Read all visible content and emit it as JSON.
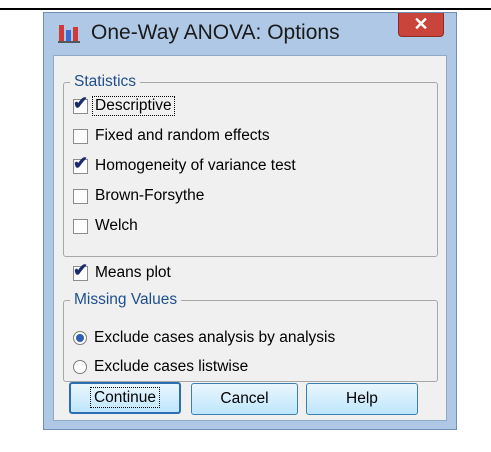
{
  "window": {
    "title": "One-Way ANOVA: Options",
    "close_symbol": "✕",
    "app_icon": "spss-chart-icon"
  },
  "statistics": {
    "legend": "Statistics",
    "options": [
      {
        "label": "Descriptive",
        "checked": true
      },
      {
        "label": "Fixed and random effects",
        "checked": false
      },
      {
        "label": "Homogeneity of variance test",
        "checked": true
      },
      {
        "label": "Brown-Forsythe",
        "checked": false
      },
      {
        "label": "Welch",
        "checked": false
      }
    ]
  },
  "means_plot": {
    "label": "Means plot",
    "checked": true
  },
  "missing_values": {
    "legend": "Missing Values",
    "options": [
      {
        "label": "Exclude cases analysis by analysis",
        "selected": true
      },
      {
        "label": "Exclude cases listwise",
        "selected": false
      }
    ]
  },
  "buttons": {
    "continue": "Continue",
    "cancel": "Cancel",
    "help": "Help"
  },
  "check_mark": "✔"
}
